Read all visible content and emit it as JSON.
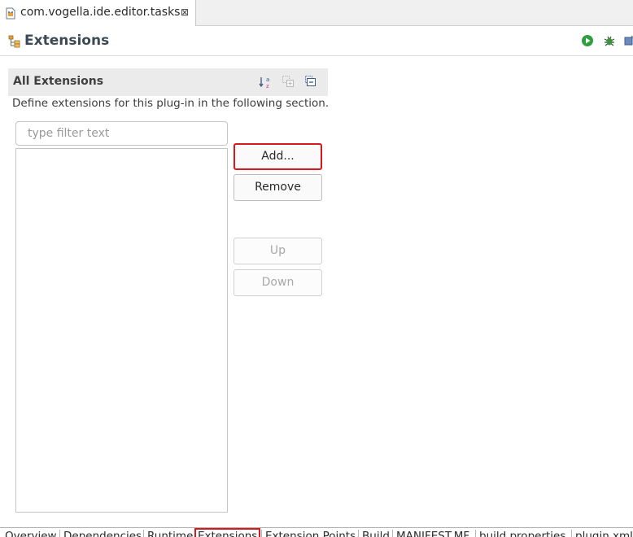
{
  "editor_tab": {
    "title": "com.vogella.ide.editor.tasks",
    "close_glyph": "⊠",
    "icon": "plugin-manifest-icon"
  },
  "form_header": {
    "title": "Extensions",
    "icon": "extensions-icon",
    "actions": [
      "run-icon",
      "debug-icon",
      "export-wizard-icon"
    ]
  },
  "section": {
    "title": "All Extensions",
    "description": "Define extensions for this plug-in in the following section.",
    "tools": [
      "sort-alphabetically-icon",
      "expand-all-icon",
      "collapse-all-icon"
    ],
    "filter": {
      "placeholder": "type filter text",
      "value": ""
    },
    "buttons": {
      "add": "Add...",
      "remove": "Remove",
      "up": "Up",
      "down": "Down"
    }
  },
  "page_tabs": {
    "overview": "Overview",
    "dependencies": "Dependencies",
    "runtime": "Runtime",
    "extensions": "Extensions",
    "extension_points": "Extension Points",
    "build": "Build",
    "manifest": "MANIFEST.MF",
    "build_properties": "build.properties",
    "plugin_xml": "plugin.xml",
    "active": "Extensions"
  },
  "colors": {
    "highlight": "#d9181e",
    "section_bg": "#ebebeb",
    "title": "#3c4a56"
  }
}
